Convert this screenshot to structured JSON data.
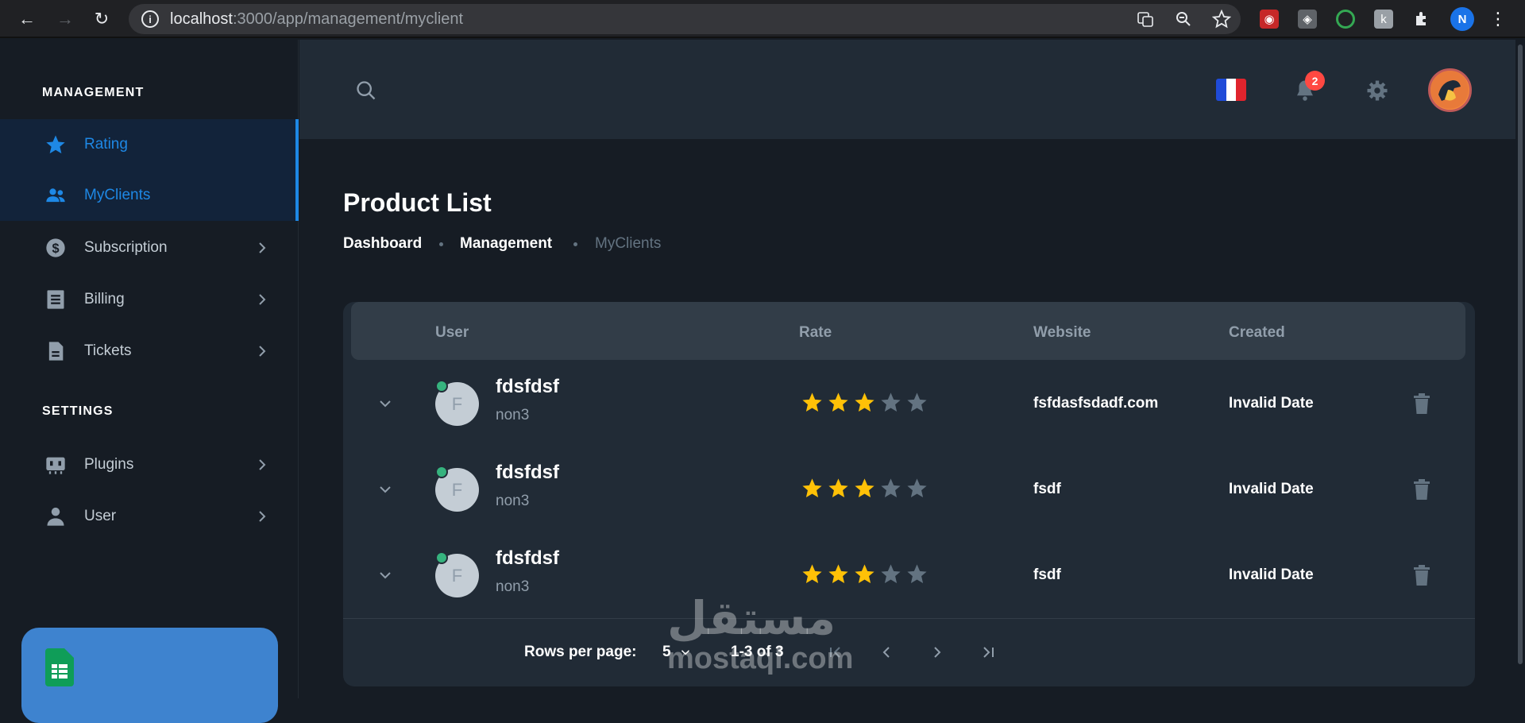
{
  "browser": {
    "url_host": "localhost",
    "url_path": ":3000/app/management/myclient",
    "profile_initial": "N"
  },
  "sidebar": {
    "management_heading": "MANAGEMENT",
    "settings_heading": "SETTINGS",
    "items": [
      {
        "label": "Rating",
        "icon": "star-icon",
        "active": true
      },
      {
        "label": "MyClients",
        "icon": "people-icon",
        "active": true
      },
      {
        "label": "Subscription",
        "icon": "dollar-icon"
      },
      {
        "label": "Billing",
        "icon": "receipt-icon"
      },
      {
        "label": "Tickets",
        "icon": "document-icon"
      },
      {
        "label": "Plugins",
        "icon": "plugin-icon"
      },
      {
        "label": "User",
        "icon": "user-icon"
      }
    ]
  },
  "header": {
    "notification_count": "2",
    "language": "French flag"
  },
  "page": {
    "title": "Product List",
    "breadcrumb": [
      "Dashboard",
      "Management",
      "MyClients"
    ]
  },
  "table": {
    "columns": [
      "User",
      "Rate",
      "Website",
      "Created"
    ],
    "rows": [
      {
        "initial": "F",
        "name": "fdsfdsf",
        "sub": "non3",
        "rating": 3,
        "website": "fsfdasfsdadf.com",
        "created": "Invalid Date"
      },
      {
        "initial": "F",
        "name": "fdsfdsf",
        "sub": "non3",
        "rating": 3,
        "website": "fsdf",
        "created": "Invalid Date"
      },
      {
        "initial": "F",
        "name": "fdsfdsf",
        "sub": "non3",
        "rating": 3,
        "website": "fsdf",
        "created": "Invalid Date"
      }
    ],
    "rating_max": 5
  },
  "pagination": {
    "rows_per_page_label": "Rows per page:",
    "rows_per_page": "5",
    "range": "1-3 of 3"
  },
  "watermark": {
    "arabic": "مستقل",
    "latin": "mostaql.com"
  },
  "colors": {
    "accent": "#1e88e5",
    "star_filled": "#ffc107",
    "star_empty": "#637381",
    "online": "#36b37e",
    "badge": "#ff4842"
  }
}
